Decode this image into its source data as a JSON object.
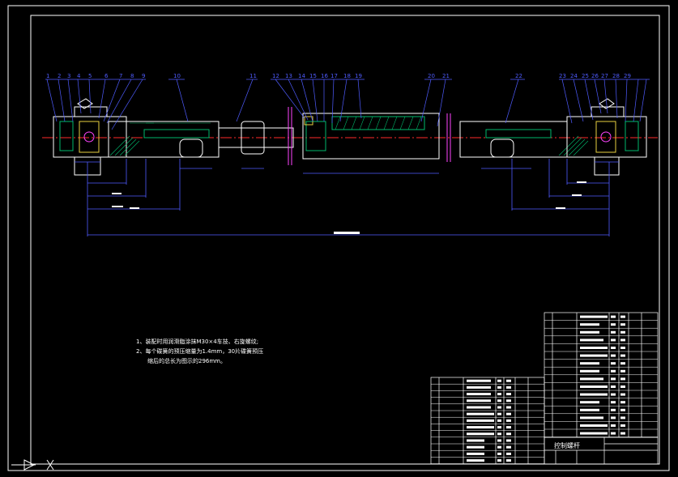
{
  "drawing": {
    "title_block_name": "控制螺杆",
    "notes": [
      "1、装配时用润滑脂涂抹M30×4车技、右旋螺纹;",
      "2、每个碟簧的预压缩量为1.4mm，30片碟簧预压",
      "缩后的总长为图示的296mm。"
    ],
    "part_balloons_left": [
      "1",
      "2",
      "3",
      "4",
      "5",
      "6",
      "7",
      "8",
      "9",
      "10",
      "11",
      "12",
      "13",
      "14",
      "15",
      "16",
      "17",
      "18",
      "19",
      "20",
      "21"
    ],
    "part_balloons_right": [
      "22",
      "23",
      "24",
      "25",
      "26",
      "27",
      "28",
      "29"
    ]
  },
  "colors": {
    "background": "#000000",
    "outline": "#ffffff",
    "leader": "#4f5cff",
    "hatch": "#00b86b",
    "centerline": "#ff2a2a",
    "accent": "#ff44ff",
    "component_yellow": "#e8d040"
  }
}
